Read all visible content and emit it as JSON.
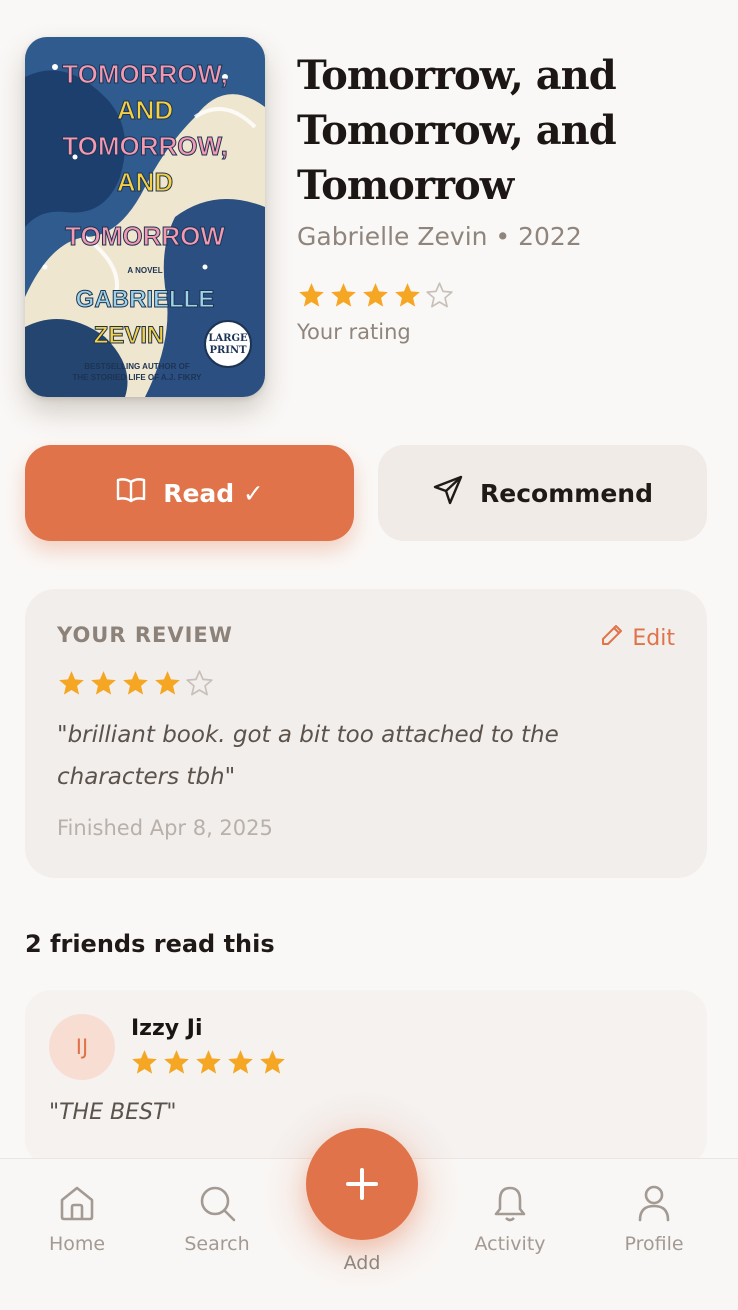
{
  "book": {
    "title": "Tomorrow, and Tomorrow, and Tomorrow",
    "author_year": "Gabrielle Zevin • 2022",
    "user_rating": 4,
    "rating_label": "Your rating",
    "cover": {
      "title_lines": [
        "TOMORROW,",
        "AND",
        "TOMORROW,",
        "AND",
        "TOMORROW"
      ],
      "tagline": "A NOVEL",
      "author_lines": [
        "GABRIELLE",
        "ZEVIN"
      ],
      "blurb_lines": [
        "BESTSELLING AUTHOR OF",
        "THE STORIED LIFE OF A.J. FIKRY"
      ],
      "badge_lines": [
        "LARGE",
        "PRINT"
      ]
    }
  },
  "actions": {
    "read_label": "Read ✓",
    "recommend_label": "Recommend"
  },
  "review": {
    "heading": "YOUR REVIEW",
    "edit_label": "Edit",
    "rating": 4,
    "text": "\"brilliant book. got a bit too attached to the characters tbh\"",
    "finished": "Finished Apr 8, 2025"
  },
  "friends": {
    "heading": "2 friends read this",
    "items": [
      {
        "initials": "IJ",
        "name": "Izzy Ji",
        "rating": 5,
        "review": "\"THE BEST\""
      }
    ]
  },
  "nav": {
    "home": "Home",
    "search": "Search",
    "add": "Add",
    "activity": "Activity",
    "profile": "Profile"
  },
  "colors": {
    "accent": "#e07349",
    "star": "#f5a623",
    "background": "#faf8f6"
  }
}
